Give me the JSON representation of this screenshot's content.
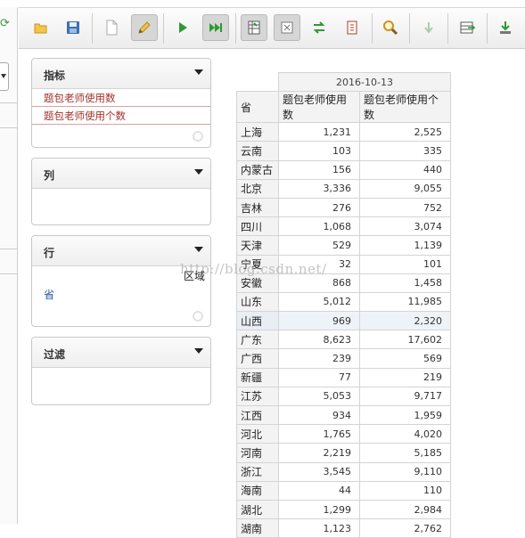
{
  "toolbar": {
    "buttons": [
      {
        "name": "open",
        "icon": "folder-open-icon"
      },
      {
        "name": "save",
        "icon": "save-icon"
      },
      {
        "name": "new",
        "icon": "new-document-icon"
      },
      {
        "name": "edit",
        "icon": "pencil-icon"
      },
      {
        "name": "run",
        "icon": "play-icon"
      },
      {
        "name": "auto-run",
        "icon": "auto-run-icon"
      },
      {
        "name": "hide-parents",
        "icon": "hide-parents-icon"
      },
      {
        "name": "non-empty",
        "icon": "non-empty-icon"
      },
      {
        "name": "swap-axis",
        "icon": "swap-axis-icon"
      },
      {
        "name": "fullscreen",
        "icon": "fullscreen-icon"
      },
      {
        "name": "zoom",
        "icon": "magnifier-icon"
      },
      {
        "name": "drill-down",
        "icon": "drill-down-icon"
      },
      {
        "name": "export-table",
        "icon": "export-table-icon"
      },
      {
        "name": "export-download",
        "icon": "download-icon"
      }
    ]
  },
  "panels": {
    "measures": {
      "title": "指标",
      "items": [
        "题包老师使用数",
        "题包老师使用个数"
      ]
    },
    "columns": {
      "title": "列"
    },
    "rows": {
      "title": "行",
      "items": [
        "省"
      ]
    },
    "filter": {
      "title": "过滤"
    }
  },
  "drag_hint": "区域",
  "watermark": "http://blog.csdn.net/",
  "colors": {
    "measure_text": "#a0322a",
    "row_text": "#2a5a9a",
    "run_green": "#2e9a2e"
  },
  "table": {
    "date": "2016-10-13",
    "header_row_label": "省",
    "columns": [
      "题包老师使用数",
      "题包老师使用个数"
    ],
    "selected_row": "山西",
    "rows": [
      {
        "province": "上海",
        "v1": "1,231",
        "v2": "2,525"
      },
      {
        "province": "云南",
        "v1": "103",
        "v2": "335"
      },
      {
        "province": "内蒙古",
        "v1": "156",
        "v2": "440"
      },
      {
        "province": "北京",
        "v1": "3,336",
        "v2": "9,055"
      },
      {
        "province": "吉林",
        "v1": "276",
        "v2": "752"
      },
      {
        "province": "四川",
        "v1": "1,068",
        "v2": "3,074"
      },
      {
        "province": "天津",
        "v1": "529",
        "v2": "1,139"
      },
      {
        "province": "宁夏",
        "v1": "32",
        "v2": "101"
      },
      {
        "province": "安徽",
        "v1": "868",
        "v2": "1,458"
      },
      {
        "province": "山东",
        "v1": "5,012",
        "v2": "11,985"
      },
      {
        "province": "山西",
        "v1": "969",
        "v2": "2,320"
      },
      {
        "province": "广东",
        "v1": "8,623",
        "v2": "17,602"
      },
      {
        "province": "广西",
        "v1": "239",
        "v2": "569"
      },
      {
        "province": "新疆",
        "v1": "77",
        "v2": "219"
      },
      {
        "province": "江苏",
        "v1": "5,053",
        "v2": "9,717"
      },
      {
        "province": "江西",
        "v1": "934",
        "v2": "1,959"
      },
      {
        "province": "河北",
        "v1": "1,765",
        "v2": "4,020"
      },
      {
        "province": "河南",
        "v1": "2,219",
        "v2": "5,185"
      },
      {
        "province": "浙江",
        "v1": "3,545",
        "v2": "9,110"
      },
      {
        "province": "海南",
        "v1": "44",
        "v2": "110"
      },
      {
        "province": "湖北",
        "v1": "1,299",
        "v2": "2,984"
      },
      {
        "province": "湖南",
        "v1": "1,123",
        "v2": "2,762"
      }
    ]
  }
}
